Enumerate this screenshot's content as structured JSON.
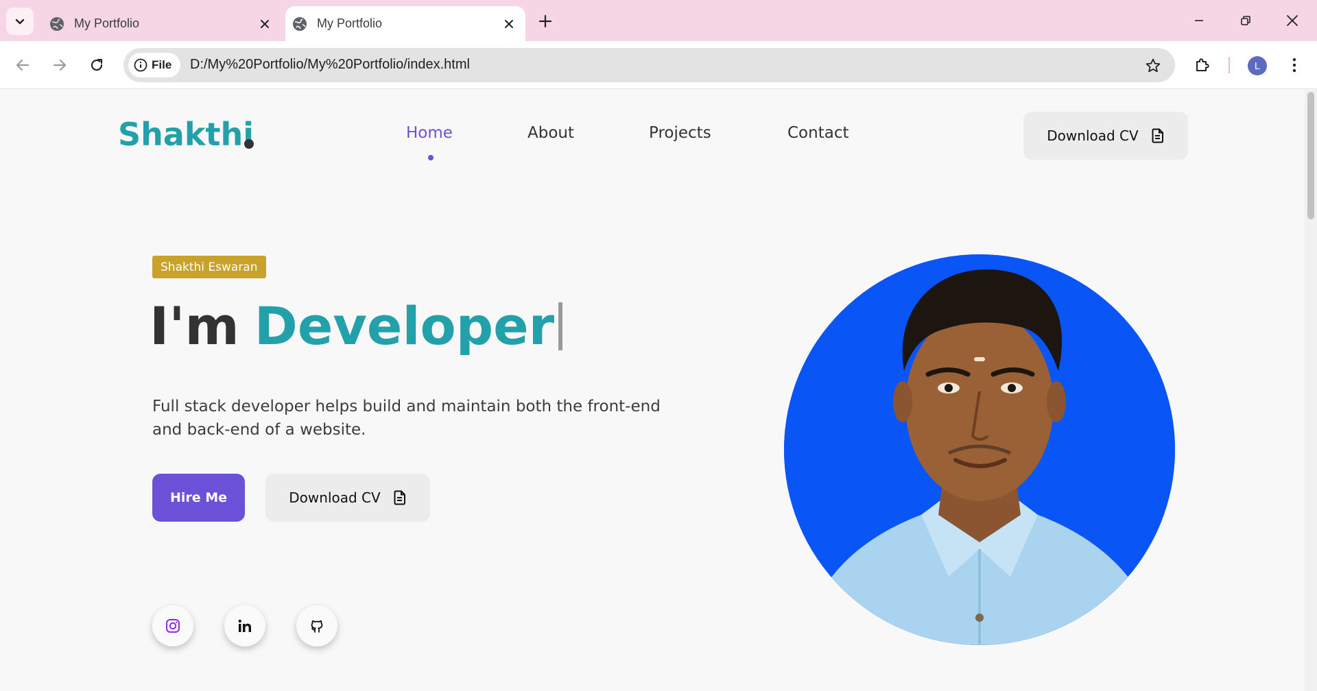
{
  "browser": {
    "tabs": [
      {
        "title": "My Portfolio",
        "active": false
      },
      {
        "title": "My Portfolio",
        "active": true
      }
    ],
    "site_chip_label": "File",
    "url": "D:/My%20Portfolio/My%20Portfolio/index.html",
    "profile_initial": "L"
  },
  "header": {
    "logo": "Shakthi",
    "nav": [
      "Home",
      "About",
      "Projects",
      "Contact"
    ],
    "active_nav": "Home",
    "download_cv": "Download CV"
  },
  "hero": {
    "badge": "Shakthi Eswaran",
    "headline_prefix": "I'm",
    "headline_typed": "Developer",
    "description": "Full stack developer helps build and maintain both the front-end and back-end of a website.",
    "hire_button": "Hire Me",
    "download_cv": "Download CV",
    "social_icons": [
      "instagram-icon",
      "linkedin-icon",
      "github-icon"
    ]
  },
  "colors": {
    "tabbar_bg": "#f6d5e5",
    "accent_teal": "#23a1ab",
    "accent_purple": "#6b50d8",
    "badge_gold": "#c9a22c",
    "photo_bg_blue": "#0a55f5"
  }
}
